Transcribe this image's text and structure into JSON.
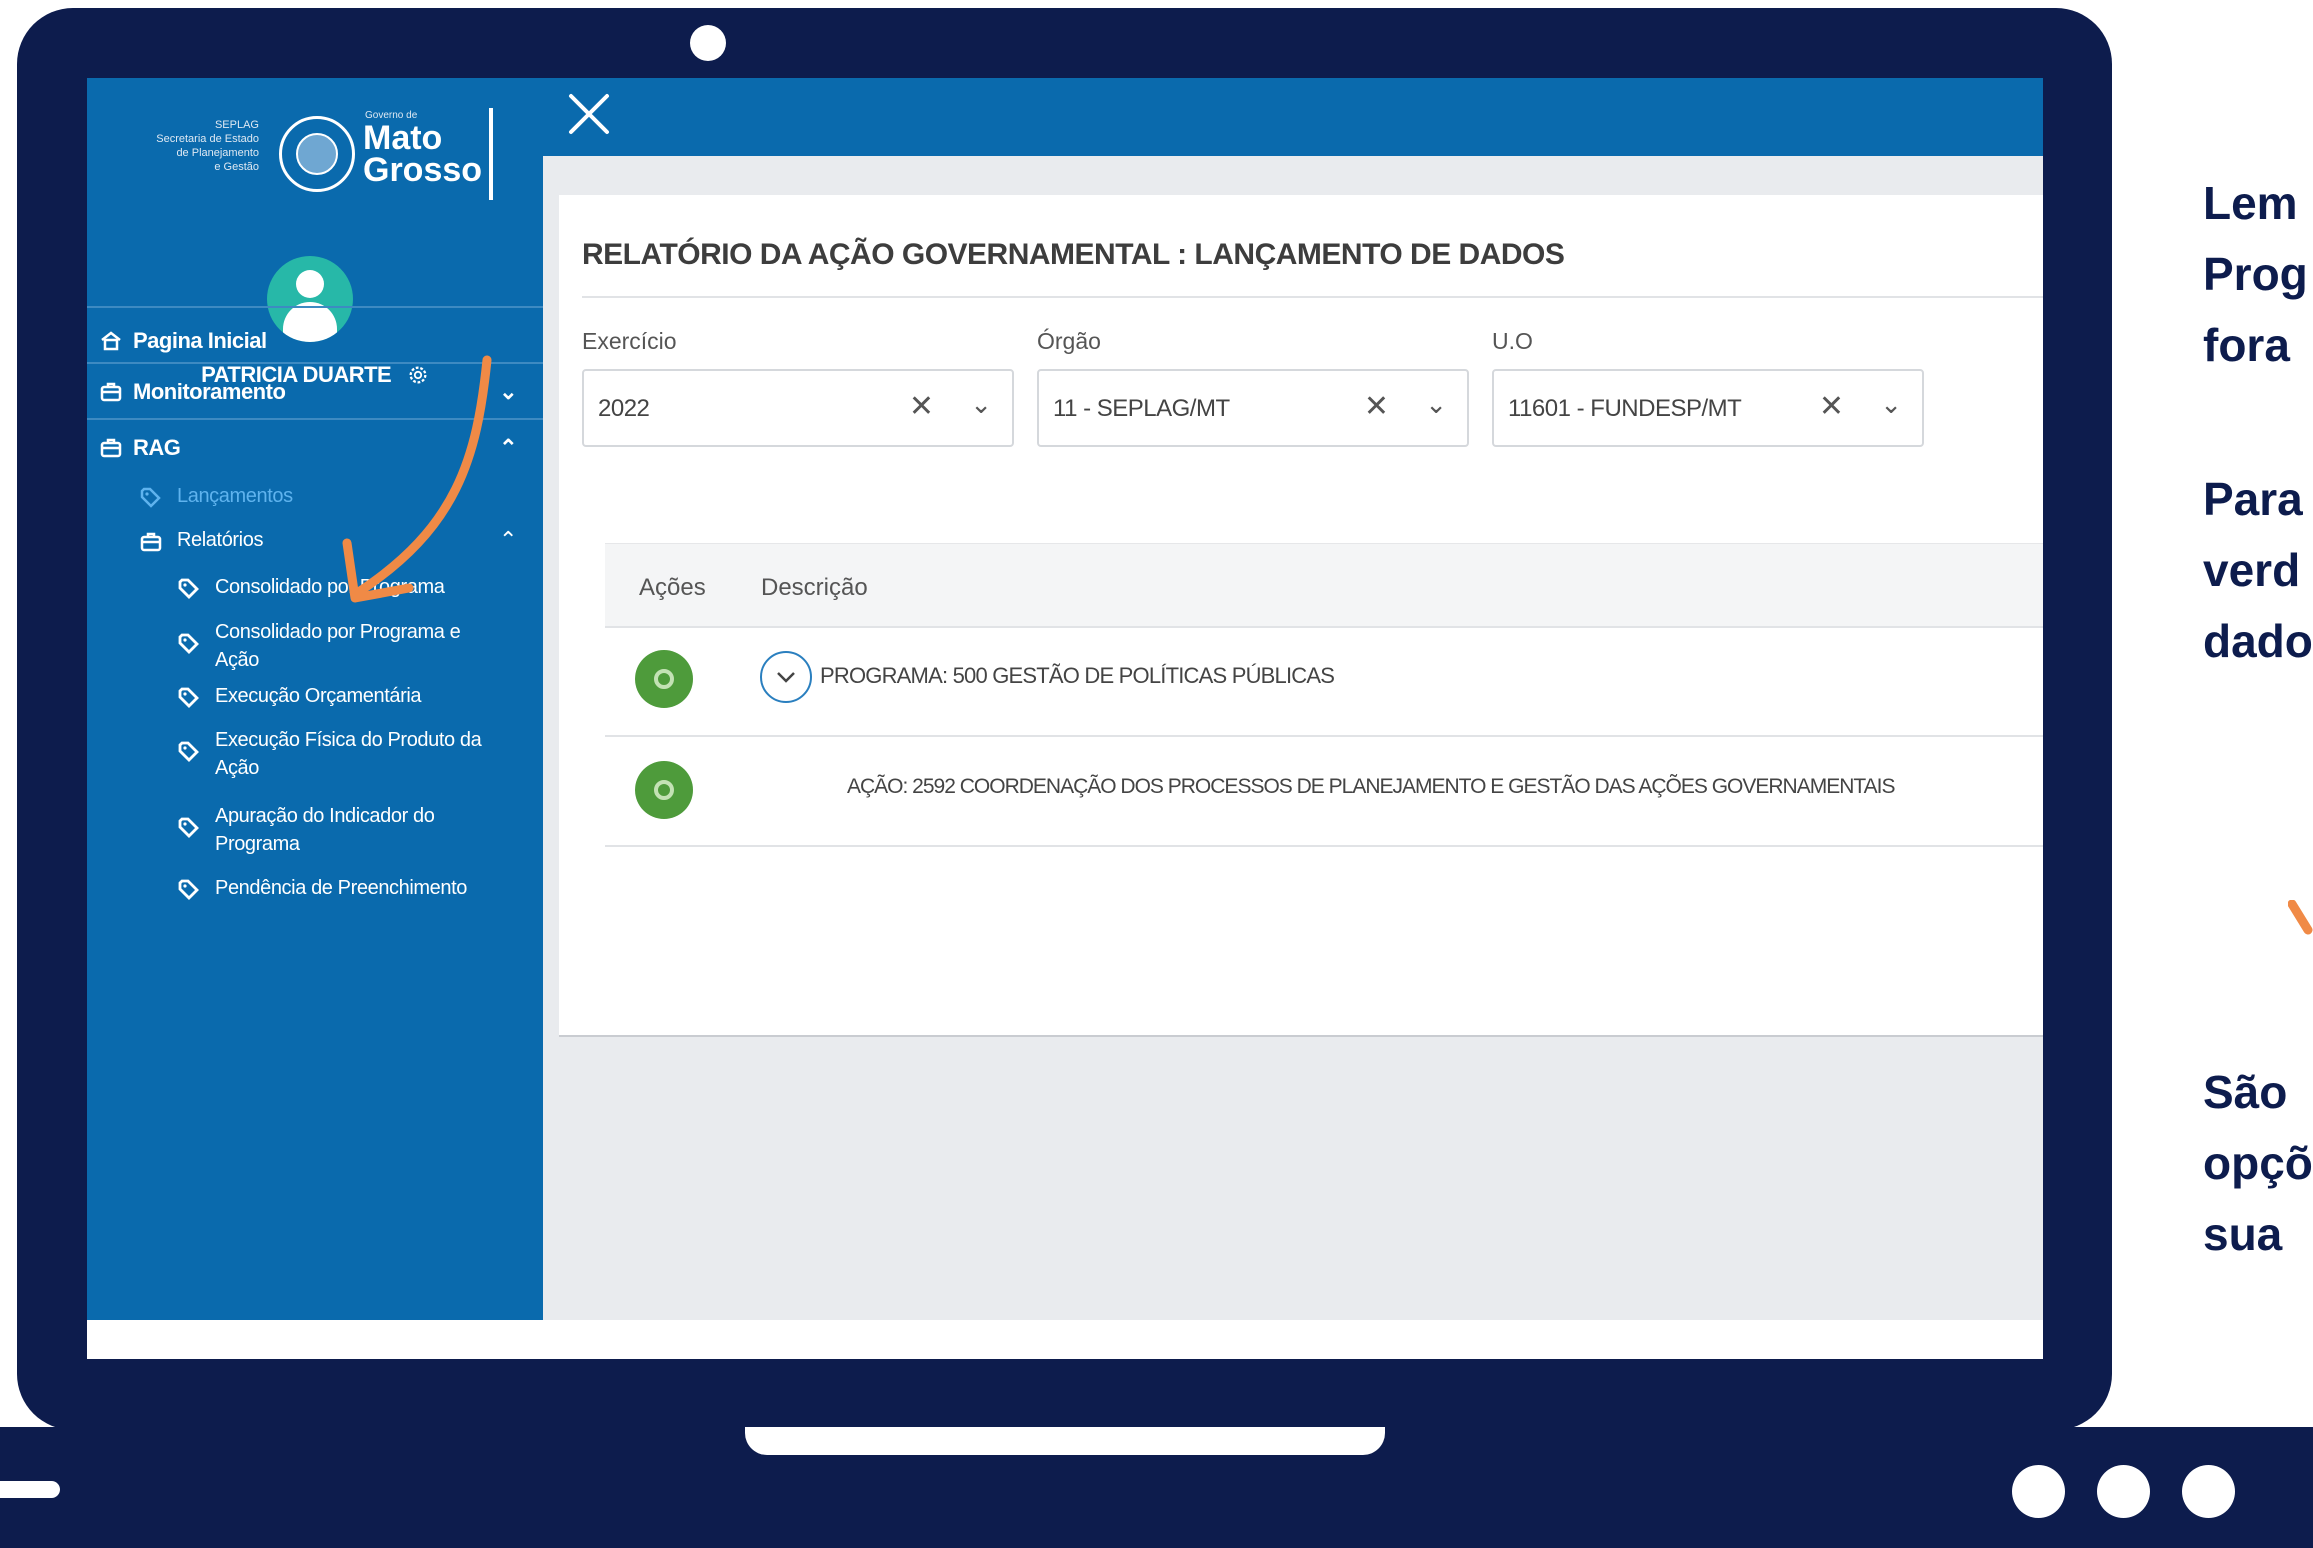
{
  "sidebar": {
    "logo": {
      "small_lines": [
        "SEPLAG",
        "Secretaria de Estado",
        "de Planejamento",
        "e Gestão"
      ],
      "gov_label": "Governo de",
      "name_line1": "Mato",
      "name_line2": "Grosso"
    },
    "user_name": "PATRICIA DUARTE",
    "nav": [
      {
        "label": "Pagina Inicial",
        "icon": "home-icon"
      },
      {
        "label": "Monitoramento",
        "icon": "briefcase-icon",
        "chevron": "⌄"
      },
      {
        "label": "RAG",
        "icon": "briefcase-icon",
        "chevron": "⌃"
      }
    ],
    "rag_items": {
      "lancamentos": "Lançamentos",
      "relatorios": "Relatórios",
      "relatorios_chevron": "⌃"
    },
    "report_items": [
      {
        "line1": "Consolidado por Programa",
        "line2": ""
      },
      {
        "line1": "Consolidado por Programa e",
        "line2": "Ação"
      },
      {
        "line1": "Execução Orçamentária",
        "line2": ""
      },
      {
        "line1": "Execução Física do Produto da",
        "line2": "Ação"
      },
      {
        "line1": "Apuração do Indicador do",
        "line2": "Programa"
      },
      {
        "line1": "Pendência de Preenchimento",
        "line2": ""
      }
    ]
  },
  "main": {
    "title": "RELATÓRIO DA AÇÃO GOVERNAMENTAL : LANÇAMENTO DE DADOS",
    "filters": [
      {
        "label": "Exercício",
        "value": "2022"
      },
      {
        "label": "Órgão",
        "value": "11 - SEPLAG/MT"
      },
      {
        "label": "U.O",
        "value": "11601 - FUNDESP/MT"
      }
    ],
    "clear_glyph": "✕",
    "dropdown_glyph": "⌄",
    "table": {
      "headers": [
        "Ações",
        "Descrição"
      ],
      "rows": [
        {
          "text": "PROGRAMA: 500 GESTÃO DE POLÍTICAS PÚBLICAS"
        },
        {
          "text": "AÇÃO: 2592 COORDENAÇÃO DOS PROCESSOS DE PLANEJAMENTO E GESTÃO DAS AÇÕES GOVERNAMENTAIS"
        }
      ]
    }
  },
  "side_text": {
    "block1": [
      "Lem",
      "Prog",
      "fora"
    ],
    "block2": [
      "Para",
      "verd",
      "dado"
    ],
    "block3": [
      "São",
      "opçõ",
      "sua"
    ]
  },
  "colors": {
    "sidebar": "#0a6aad",
    "frame": "#0d1c4d",
    "action_button": "#4e9b3b",
    "annotation_arrow": "#f08a46"
  }
}
